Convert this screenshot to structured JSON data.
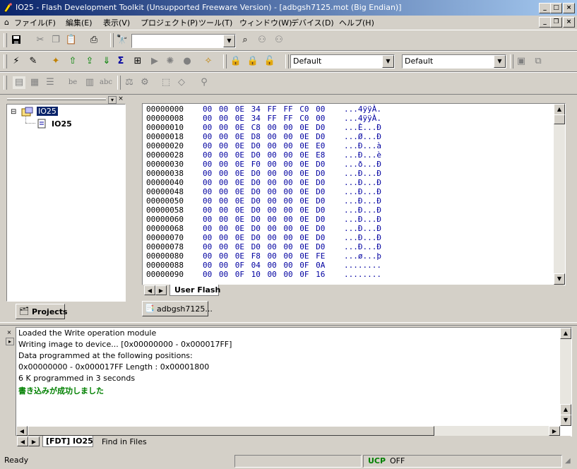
{
  "window": {
    "title": "IO25 - Flash Development Toolkit  (Unsupported Freeware Version) - [adbgsh7125.mot  (Big Endian)]",
    "minimize_glyph": "_",
    "maximize_glyph": "□",
    "close_glyph": "×",
    "restore_glyph": "❐"
  },
  "menu": [
    "ファイル(F)",
    "編集(E)",
    "表示(V)",
    "プロジェクト(P)",
    "ツール(T)",
    "ウィンドウ(W)",
    "デバイス(D)",
    "ヘルプ(H)"
  ],
  "toolbar": {
    "combo1_value": "",
    "combo2_value": "Default",
    "combo3_value": "Default",
    "btn_be": "be",
    "btn_abc": "abc"
  },
  "project_tree": {
    "root": "IO25",
    "child": "IO25",
    "tab_label": "Projects"
  },
  "hex_view": {
    "rows": [
      {
        "addr": "00000000",
        "bytes": "00 00 0E 34 FF FF C0 00",
        "ascii": "...4ÿÿÀ."
      },
      {
        "addr": "00000008",
        "bytes": "00 00 0E 34 FF FF C0 00",
        "ascii": "...4ÿÿÀ."
      },
      {
        "addr": "00000010",
        "bytes": "00 00 0E C8 00 00 0E D0",
        "ascii": "...È...Ð"
      },
      {
        "addr": "00000018",
        "bytes": "00 00 0E D8 00 00 0E D0",
        "ascii": "...Ø...Ð"
      },
      {
        "addr": "00000020",
        "bytes": "00 00 0E D0 00 00 0E E0",
        "ascii": "...Ð...à"
      },
      {
        "addr": "00000028",
        "bytes": "00 00 0E D0 00 00 0E E8",
        "ascii": "...Ð...è"
      },
      {
        "addr": "00000030",
        "bytes": "00 00 0E F0 00 00 0E D0",
        "ascii": "...ð...Ð"
      },
      {
        "addr": "00000038",
        "bytes": "00 00 0E D0 00 00 0E D0",
        "ascii": "...Ð...Ð"
      },
      {
        "addr": "00000040",
        "bytes": "00 00 0E D0 00 00 0E D0",
        "ascii": "...Ð...Ð"
      },
      {
        "addr": "00000048",
        "bytes": "00 00 0E D0 00 00 0E D0",
        "ascii": "...Ð...Ð"
      },
      {
        "addr": "00000050",
        "bytes": "00 00 0E D0 00 00 0E D0",
        "ascii": "...Ð...Ð"
      },
      {
        "addr": "00000058",
        "bytes": "00 00 0E D0 00 00 0E D0",
        "ascii": "...Ð...Ð"
      },
      {
        "addr": "00000060",
        "bytes": "00 00 0E D0 00 00 0E D0",
        "ascii": "...Ð...Ð"
      },
      {
        "addr": "00000068",
        "bytes": "00 00 0E D0 00 00 0E D0",
        "ascii": "...Ð...Ð"
      },
      {
        "addr": "00000070",
        "bytes": "00 00 0E D0 00 00 0E D0",
        "ascii": "...Ð...Ð"
      },
      {
        "addr": "00000078",
        "bytes": "00 00 0E D0 00 00 0E D0",
        "ascii": "...Ð...Ð"
      },
      {
        "addr": "00000080",
        "bytes": "00 00 0E F8 00 00 0E FE",
        "ascii": "...ø...þ"
      },
      {
        "addr": "00000088",
        "bytes": "00 00 0F 04 00 00 0F 0A",
        "ascii": "........"
      },
      {
        "addr": "00000090",
        "bytes": "00 00 0F 10 00 00 0F 16",
        "ascii": "........"
      }
    ],
    "tab_label": "User Flash",
    "doc_tab_label": "adbgsh7125..."
  },
  "output": {
    "lines": [
      "Loaded the Write operation module",
      "Writing image to device... [0x00000000 - 0x000017FF]",
      "Data programmed at the following positions:",
      " 0x00000000 - 0x000017FF       Length : 0x00001800",
      "6 K programmed in 3 seconds"
    ],
    "success_line": "書き込みが成功しました",
    "success_color": "#008000",
    "tabs": [
      "[FDT] IO25",
      "Find in Files"
    ]
  },
  "status": {
    "text": "Ready",
    "ucp": "UCP",
    "ucp_color": "#008000",
    "ovr": "OFF"
  },
  "icons": {
    "collapse": "⊟",
    "arrow_up": "▲",
    "arrow_down": "▼",
    "arrow_left": "◀",
    "arrow_right": "▶"
  }
}
